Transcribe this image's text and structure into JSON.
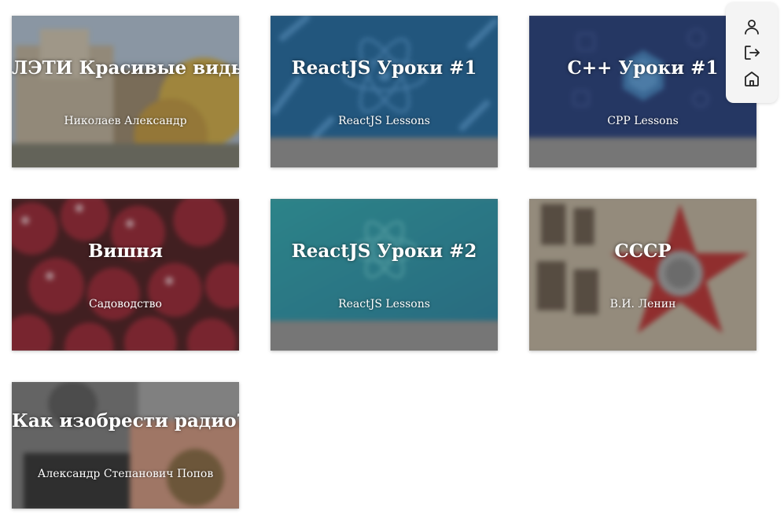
{
  "cards": [
    {
      "title": "ЛЭТИ Красивые виды",
      "subtitle": "Николаев Александр"
    },
    {
      "title": "ReactJS Уроки #1",
      "subtitle": "ReactJS Lessons"
    },
    {
      "title": "C++ Уроки #1",
      "subtitle": "CPP Lessons"
    },
    {
      "title": "Вишня",
      "subtitle": "Садоводство"
    },
    {
      "title": "ReactJS Уроки #2",
      "subtitle": "ReactJS Lessons"
    },
    {
      "title": "СССР",
      "subtitle": "В.И. Ленин"
    },
    {
      "title": "Как изобрести радио?",
      "subtitle": "Александр Степанович Попов"
    }
  ],
  "side_panel": {
    "icons": [
      "user-icon",
      "logout-icon",
      "home-icon"
    ]
  },
  "colors": {
    "react_blue": "#0a5a96",
    "cpp_navy": "#0f2a6e",
    "react_teal": "#1696a4",
    "card_gray": "#8a8a8a"
  }
}
